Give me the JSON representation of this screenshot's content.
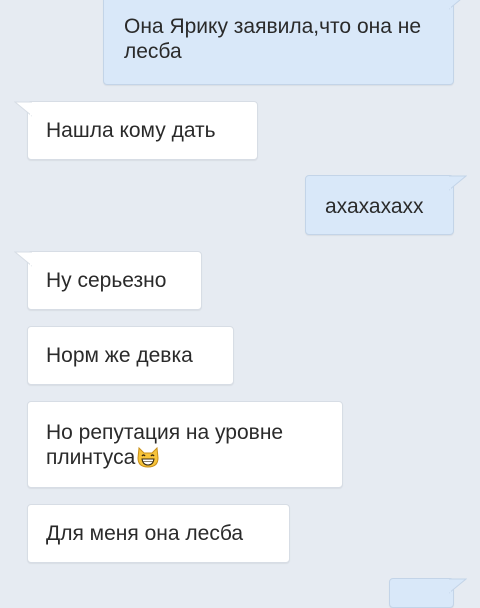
{
  "messages": [
    {
      "direction": "outgoing",
      "text": "Она Ярику заявила,что она не лесба"
    },
    {
      "direction": "incoming",
      "text": "Нашла кому дать"
    },
    {
      "direction": "outgoing",
      "text": "ахахахахх"
    },
    {
      "direction": "incoming",
      "text": "Ну серьезно"
    },
    {
      "direction": "incoming",
      "text": "Норм же девка"
    },
    {
      "direction": "incoming",
      "text": "Но репутация на уровне плинтуса",
      "emoji": "grinning-cat-emoji"
    },
    {
      "direction": "incoming",
      "text": "Для меня она лесба"
    },
    {
      "direction": "outgoing",
      "text": ""
    }
  ],
  "colors": {
    "background": "#e6ebf2",
    "incoming_bubble": "#ffffff",
    "outgoing_bubble": "#d9e8f9",
    "text": "#2a2a2a"
  }
}
